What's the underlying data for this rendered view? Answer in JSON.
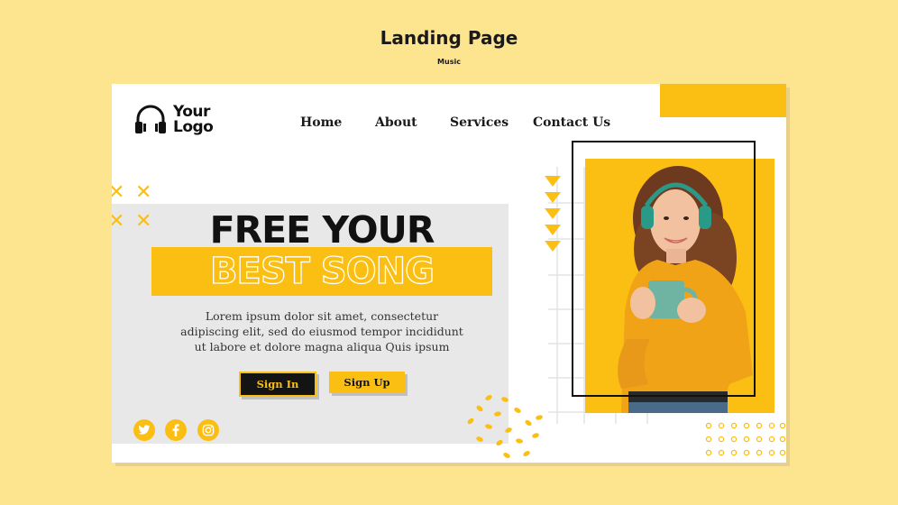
{
  "page": {
    "title": "Landing Page",
    "subtitle": "Music"
  },
  "brand": {
    "logo_text": "Your Logo",
    "logo_line1": "Your",
    "logo_line2": "Logo",
    "logo_icon": "headphones-icon"
  },
  "nav": {
    "items": [
      {
        "label": "Home"
      },
      {
        "label": "About"
      },
      {
        "label": "Services"
      },
      {
        "label": "Contact Us"
      }
    ]
  },
  "hero": {
    "headline": "FREE YOUR",
    "headline_highlight": "BEST SONG",
    "body": "Lorem ipsum dolor sit amet, consectetur adipiscing elit, sed do eiusmod tempor incididunt ut labore et dolore magna aliqua Quis ipsum",
    "body_line1": "Lorem ipsum dolor sit amet, consectetur",
    "body_line2": "adipiscing elit, sed do eiusmod tempor incididunt",
    "body_line3": "ut labore et dolore magna aliqua Quis ipsum",
    "signin_label": "Sign In",
    "signup_label": "Sign Up"
  },
  "social": [
    {
      "icon": "twitter-icon"
    },
    {
      "icon": "facebook-icon"
    },
    {
      "icon": "instagram-icon"
    }
  ],
  "image": {
    "subject": "woman-with-headphones-and-mug"
  },
  "colors": {
    "background": "#fde48f",
    "accent": "#fbbf14",
    "dark": "#141414",
    "panel": "#e8e8e8",
    "card": "#ffffff"
  }
}
